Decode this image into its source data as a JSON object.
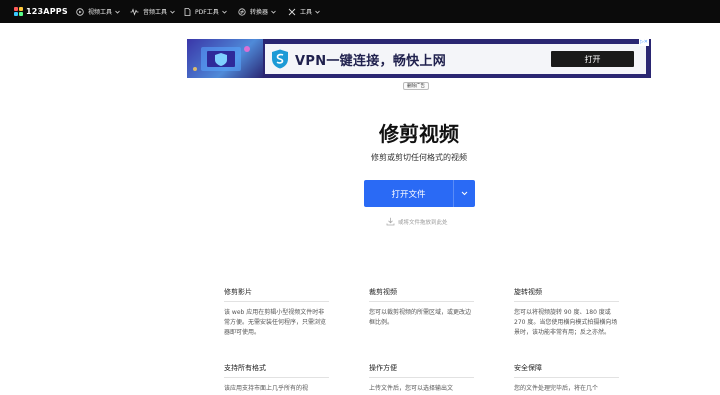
{
  "nav": {
    "logo_text": "123APPS",
    "logo_colors": [
      "#ff5a5a",
      "#ffc83a",
      "#3ac8ff",
      "#5aff8a"
    ],
    "items": [
      {
        "label": "视频工具",
        "icon": "video-icon"
      },
      {
        "label": "音频工具",
        "icon": "audio-wave-icon"
      },
      {
        "label": "PDF工具",
        "icon": "pdf-document-icon"
      },
      {
        "label": "转换器",
        "icon": "convert-arrows-icon"
      },
      {
        "label": "工具",
        "icon": "tools-icon"
      }
    ]
  },
  "ad": {
    "headline": "VPN一键连接，畅快上网",
    "button_label": "打开",
    "corner_label": "▷✕",
    "remove_label": "删除广告"
  },
  "hero": {
    "title": "修剪视频",
    "subtitle": "修剪或剪切任何格式的视频",
    "open_button_label": "打开文件",
    "drop_hint": "或将文件拖放到此处",
    "accent_color": "#2a6af5"
  },
  "features": [
    {
      "title": "修剪影片",
      "description": "该 web 应用在剪辑小型视频文件时非常方便。无需安装任何程序，只需浏览器即可使用。"
    },
    {
      "title": "裁剪视频",
      "description": "您可以裁剪视频的所需区域，或更改边框比例。"
    },
    {
      "title": "旋转视频",
      "description": "您可以将视频旋转 90 度、180 度或 270 度。当您使用横向模式拍摄横向场景时，该功能非常有用；反之亦然。"
    },
    {
      "title": "支持所有格式",
      "description": "该应用支持市面上几乎所有的视"
    },
    {
      "title": "操作方便",
      "description": "上传文件后，您可以选择输出文"
    },
    {
      "title": "安全保障",
      "description": "您的文件处理完毕后，将在几个"
    }
  ]
}
